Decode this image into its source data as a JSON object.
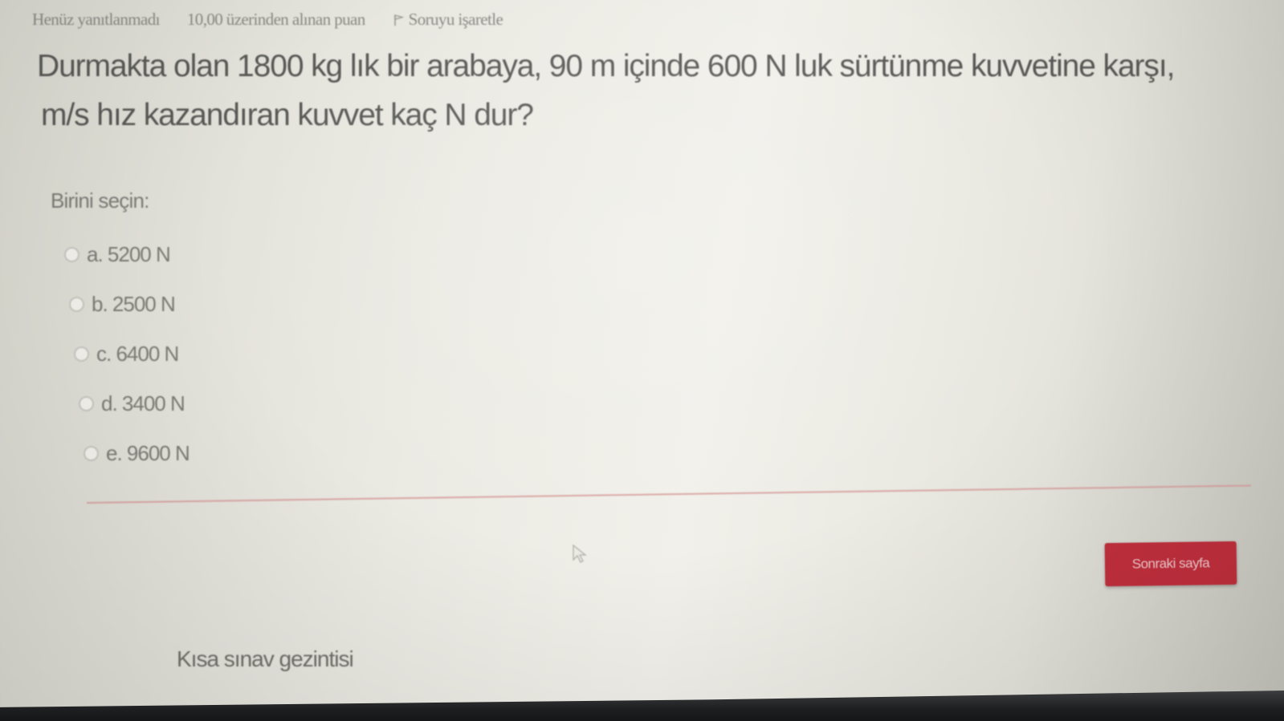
{
  "question_info": {
    "status": "Henüz yanıtlanmadı",
    "points": "10,00 üzerinden alınan puan",
    "flag_label": "Soruyu işaretle"
  },
  "question": {
    "line1": "Durmakta olan 1800 kg lık bir arabaya, 90 m içinde 600 N luk sürtünme kuvvetine karşı,",
    "line2": "m/s hız kazandıran kuvvet kaç N dur?"
  },
  "answer_prompt": "Birini seçin:",
  "options": [
    {
      "label": "a. 5200 N",
      "selected": false
    },
    {
      "label": "b. 2500 N",
      "selected": false
    },
    {
      "label": "c. 6400 N",
      "selected": false
    },
    {
      "label": "d. 3400 N",
      "selected": false
    },
    {
      "label": "e. 9600 N",
      "selected": false
    }
  ],
  "next_button_label": "Sonraki sayfa",
  "quiz_navigation_label": "Kısa sınav gezintisi",
  "colors": {
    "accent_button": "#c22f3d",
    "separator": "#d9a7a5"
  }
}
